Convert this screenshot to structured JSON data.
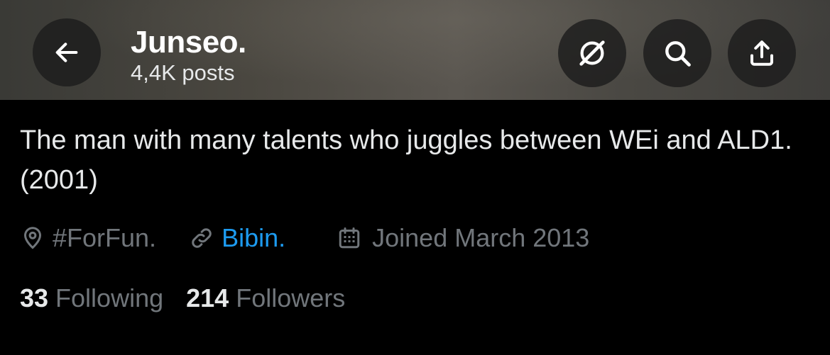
{
  "header": {
    "name": "Junseo.",
    "post_count": "4,4K posts"
  },
  "bio": "The man with many talents who juggles between WEi and ALD1. (2001)",
  "meta": {
    "location": "#ForFun.",
    "link": "Bibin.",
    "joined": "Joined March 2013"
  },
  "stats": {
    "following_count": "33",
    "following_label": "Following",
    "followers_count": "214",
    "followers_label": "Followers"
  },
  "colors": {
    "link": "#1d9bf0",
    "muted": "#71767b",
    "text": "#e7e9ea",
    "background": "#000000"
  },
  "icons": [
    "back-arrow-icon",
    "grok-icon",
    "search-icon",
    "share-icon",
    "location-pin-icon",
    "link-icon",
    "calendar-icon"
  ]
}
